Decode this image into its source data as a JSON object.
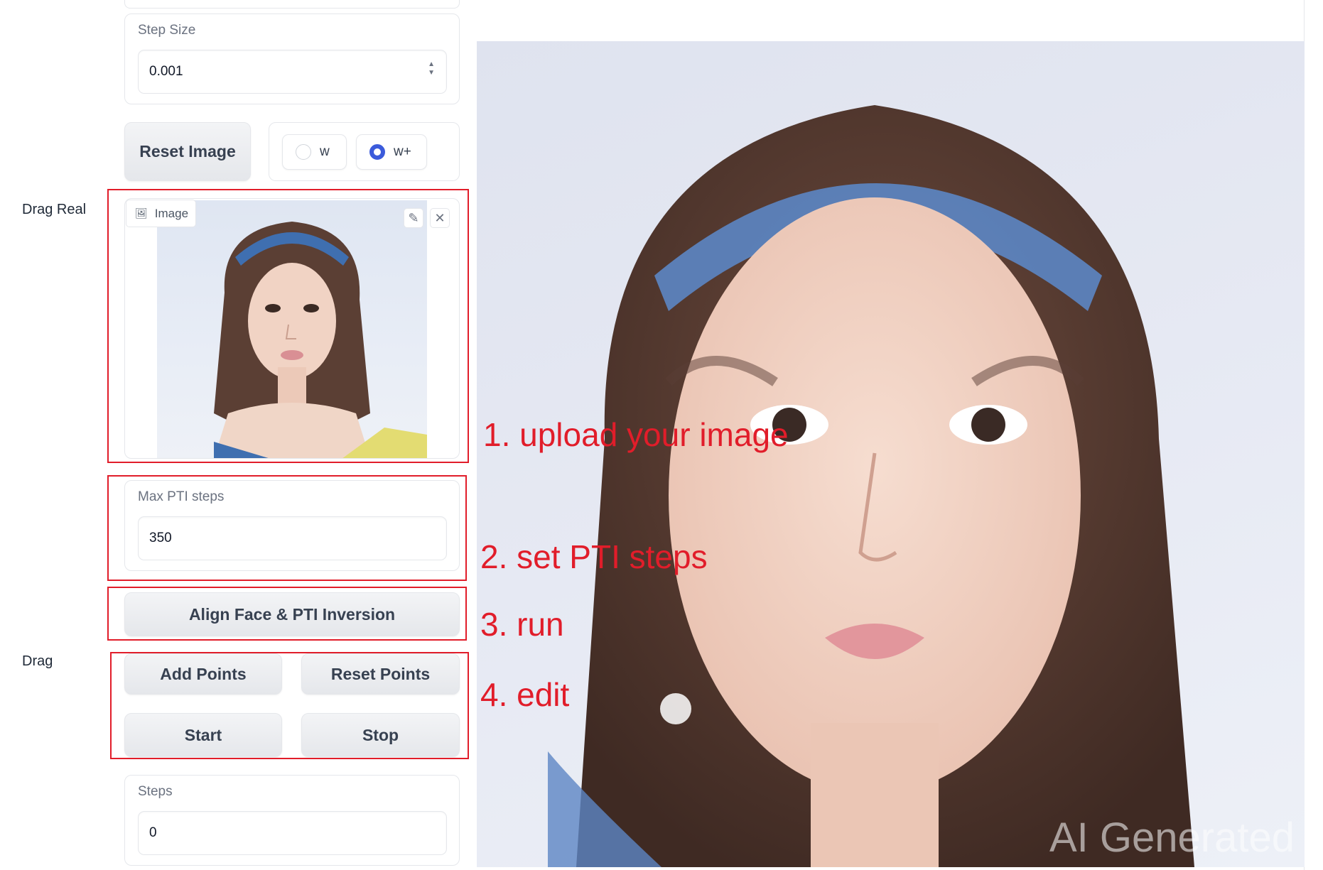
{
  "labels": {
    "drag_real": "Drag Real",
    "drag": "Drag"
  },
  "step_size": {
    "label": "Step Size",
    "value": "0.001"
  },
  "reset_image_label": "Reset Image",
  "latent_space": {
    "options": [
      "w",
      "w+"
    ],
    "selected": "w+"
  },
  "image_upload": {
    "tag": "Image"
  },
  "max_pti_steps": {
    "label": "Max PTI steps",
    "value": "350"
  },
  "align_button_label": "Align Face & PTI Inversion",
  "drag_buttons": {
    "add_points": "Add Points",
    "reset_points": "Reset Points",
    "start": "Start",
    "stop": "Stop"
  },
  "steps": {
    "label": "Steps",
    "value": "0"
  },
  "annotations": {
    "step1": "1. upload your image",
    "step2": "2. set PTI steps",
    "step3": "3. run",
    "step4": "4. edit"
  },
  "output_watermark": "AI Generated",
  "colors": {
    "annotation_red": "#e11d2a",
    "radio_selected": "#3b5bdb"
  }
}
